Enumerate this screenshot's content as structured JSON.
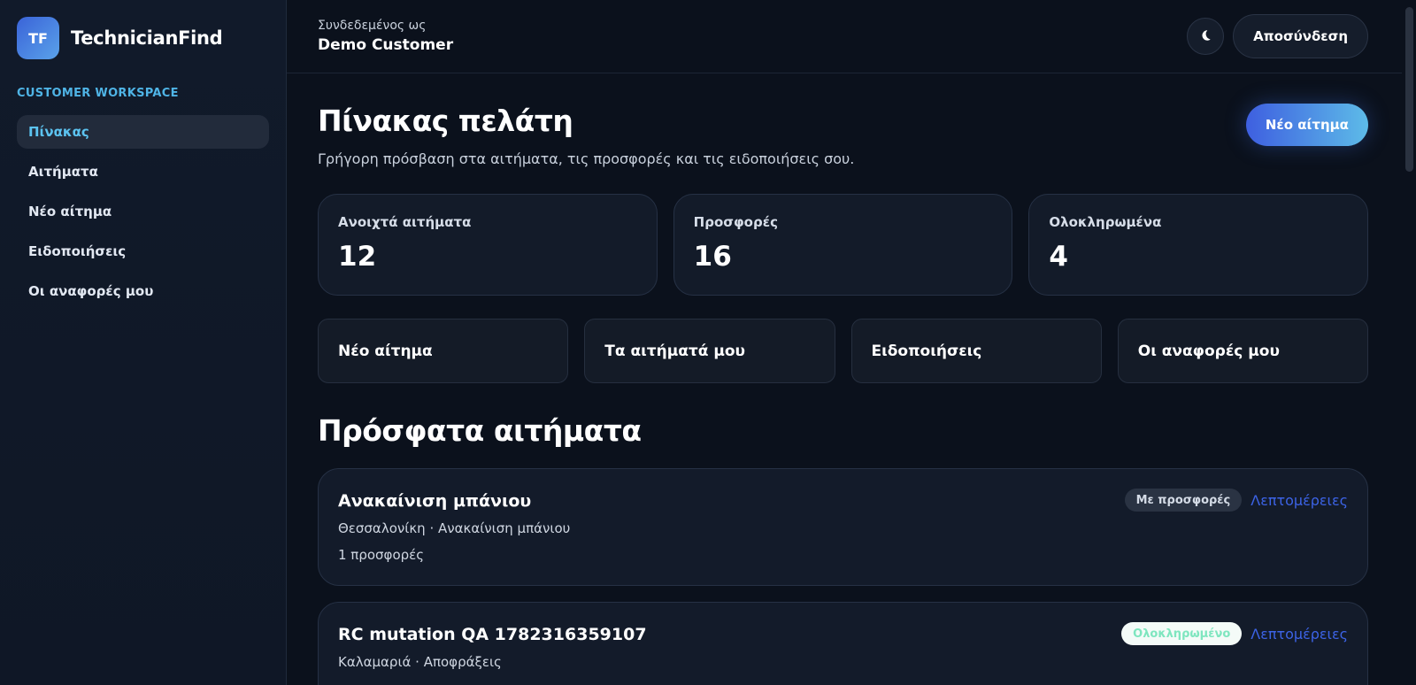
{
  "brand": {
    "logo_text": "TF",
    "name": "TechnicianFind"
  },
  "sidebar": {
    "section_label": "CUSTOMER WORKSPACE",
    "items": [
      {
        "label": "Πίνακας",
        "active": true
      },
      {
        "label": "Αιτήματα",
        "active": false
      },
      {
        "label": "Νέο αίτημα",
        "active": false
      },
      {
        "label": "Ειδοποιήσεις",
        "active": false
      },
      {
        "label": "Οι αναφορές μου",
        "active": false
      }
    ]
  },
  "topbar": {
    "signed_in_label": "Συνδεδεμένος ως",
    "user_name": "Demo Customer",
    "theme_icon": "moon-icon",
    "logout_label": "Αποσύνδεση"
  },
  "page": {
    "title": "Πίνακας πελάτη",
    "subtitle": "Γρήγορη πρόσβαση στα αιτήματα, τις προσφορές και τις ειδοποιήσεις σου.",
    "new_request_button": "Νέο αίτημα"
  },
  "stats": [
    {
      "label": "Ανοιχτά αιτήματα",
      "value": "12"
    },
    {
      "label": "Προσφορές",
      "value": "16"
    },
    {
      "label": "Ολοκληρωμένα",
      "value": "4"
    }
  ],
  "quick_links": [
    {
      "label": "Νέο αίτημα"
    },
    {
      "label": "Τα αιτήματά μου"
    },
    {
      "label": "Ειδοποιήσεις"
    },
    {
      "label": "Οι αναφορές μου"
    }
  ],
  "recent": {
    "title": "Πρόσφατα αιτήματα",
    "requests": [
      {
        "title": "Ανακαίνιση μπάνιου",
        "meta": "Θεσσαλονίκη · Ανακαίνιση μπάνιου",
        "offers": "1 προσφορές",
        "status": "Με προσφορές",
        "details_label": "Λεπτομέρειες"
      },
      {
        "title": "RC mutation QA 1782316359107",
        "meta": "Καλαμαριά · Αποφράξεις",
        "status": "Ολοκληρωμένο",
        "details_label": "Λεπτομέρειες"
      }
    ]
  },
  "colors": {
    "accent": "#5cc3f0",
    "link": "#3c63e6",
    "button_gradient_start": "#3e5fe0",
    "button_gradient_end": "#5dbbe8",
    "status_done_text": "#7ee6bf"
  }
}
